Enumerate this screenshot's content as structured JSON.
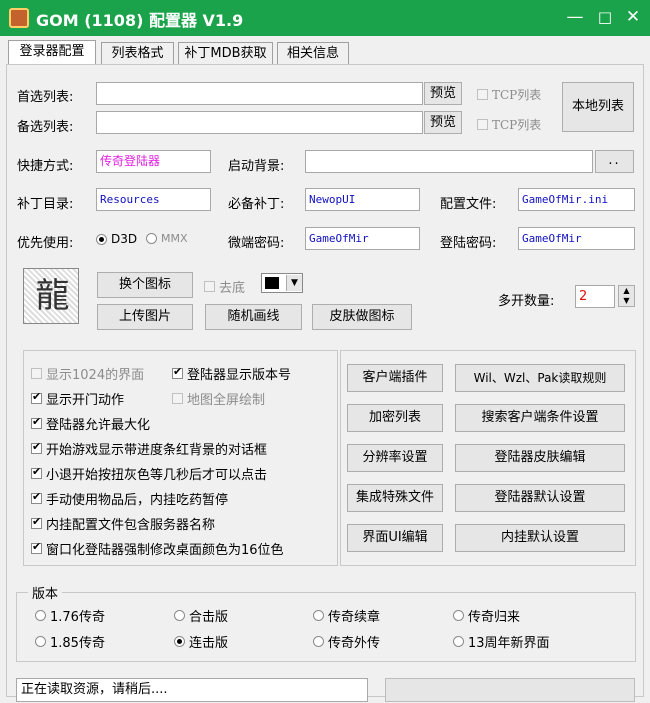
{
  "window": {
    "title": "GOM  (1108)  配置器 V1.9",
    "minimize": "—",
    "maximize": "□",
    "close": "✕"
  },
  "tabs": [
    "登录器配置",
    "列表格式",
    "补丁MDB获取",
    "相关信息"
  ],
  "fields": {
    "primary_list_label": "首选列表:",
    "primary_list_value": "",
    "secondary_list_label": "备选列表:",
    "secondary_list_value": "",
    "preview_label": "预览",
    "tcp_list_label": "TCP列表",
    "local_list_button": "本地列表",
    "shortcut_label": "快捷方式:",
    "shortcut_value": "传奇登陆器",
    "startup_bg_label": "启动背景:",
    "startup_bg_value": "",
    "browse_button": "..",
    "patch_dir_label": "补丁目录:",
    "patch_dir_value": "Resources",
    "required_patch_label": "必备补丁:",
    "required_patch_value": "NewopUI",
    "config_file_label": "配置文件:",
    "config_file_value": "GameOfMir.ini",
    "priority_label": "优先使用:",
    "d3d_label": "D3D",
    "mmx_label": "MMX",
    "micro_pwd_label": "微端密码:",
    "micro_pwd_value": "GameOfMir",
    "login_pwd_label": "登陆密码:",
    "login_pwd_value": "GameOfMir"
  },
  "icon_area": {
    "change_icon": "换个图标",
    "remove_bottom": "去底",
    "upload_image": "上传图片",
    "random_lines": "随机画线",
    "skin_icon": "皮肤做图标",
    "multi_open_label": "多开数量:",
    "multi_open_value": "2"
  },
  "options": [
    {
      "label": "显示1024的界面",
      "checked": false,
      "disabled": true
    },
    {
      "label": "登陆器显示版本号",
      "checked": true,
      "disabled": false
    },
    {
      "label": "显示开门动作",
      "checked": true,
      "disabled": false
    },
    {
      "label": "地图全屏绘制",
      "checked": false,
      "disabled": true
    },
    {
      "label": "登陆器允许最大化",
      "checked": true,
      "disabled": false
    },
    {
      "label": "开始游戏显示带进度条红背景的对话框",
      "checked": true,
      "disabled": false
    },
    {
      "label": "小退开始按扭灰色等几秒后才可以点击",
      "checked": true,
      "disabled": false
    },
    {
      "label": "手动使用物品后，内挂吃药暂停",
      "checked": true,
      "disabled": false
    },
    {
      "label": "内挂配置文件包含服务器名称",
      "checked": true,
      "disabled": false
    },
    {
      "label": "窗口化登陆器强制修改桌面颜色为16位色",
      "checked": true,
      "disabled": false
    }
  ],
  "action_buttons": [
    "客户端插件",
    "Wil、Wzl、Pak读取规则",
    "加密列表",
    "搜索客户端条件设置",
    "分辨率设置",
    "登陆器皮肤编辑",
    "集成特殊文件",
    "登陆器默认设置",
    "界面UI编辑",
    "内挂默认设置"
  ],
  "version": {
    "label": "版本",
    "options": [
      {
        "label": "1.76传奇",
        "checked": false
      },
      {
        "label": "合击版",
        "checked": false
      },
      {
        "label": "传奇续章",
        "checked": false
      },
      {
        "label": "传奇归来",
        "checked": false
      },
      {
        "label": "1.85传奇",
        "checked": false
      },
      {
        "label": "连击版",
        "checked": true
      },
      {
        "label": "传奇外传",
        "checked": false
      },
      {
        "label": "13周年新界面",
        "checked": false
      }
    ]
  },
  "status": {
    "text": "正在读取资源，请稍后....",
    "progress": 0
  },
  "colors": {
    "titlebar": "#1aa34a",
    "shortcut_text": "#e020e0",
    "field_text": "#1010c0",
    "multi_open_text": "#e01010"
  }
}
